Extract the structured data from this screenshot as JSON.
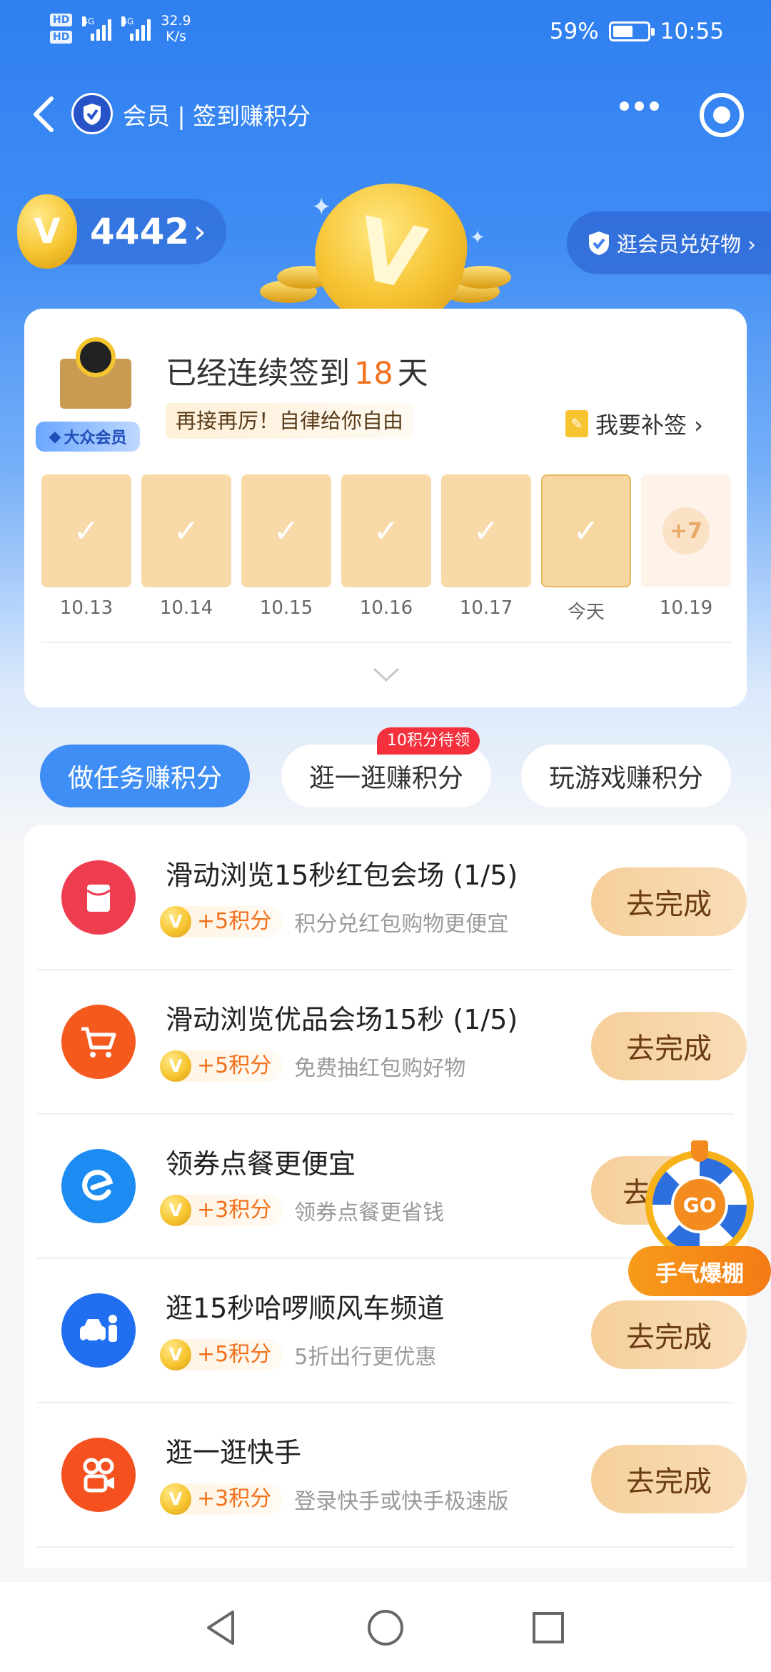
{
  "status_bar": {
    "hd1": "HD",
    "hd2": "HD",
    "net1": "4G",
    "net2": "4G",
    "speed_value": "32.9",
    "speed_unit": "K/s",
    "battery": "59%",
    "battery_level": 0.59,
    "time": "10:55"
  },
  "nav": {
    "title": "会员 | 签到赚积分"
  },
  "points": {
    "value": "4442",
    "arrow": "›"
  },
  "mall_button": "逛会员兑好物 ›",
  "sign_card": {
    "streak_prefix": "已经连续签到",
    "streak_days": "18",
    "streak_suffix": "天",
    "member_badge": "大众会员",
    "motto": "再接再厉！自律给你自由",
    "makeup_label": "我要补签 ›",
    "days": [
      {
        "label": "10.13",
        "state": "checked"
      },
      {
        "label": "10.14",
        "state": "checked"
      },
      {
        "label": "10.15",
        "state": "checked"
      },
      {
        "label": "10.16",
        "state": "checked"
      },
      {
        "label": "10.17",
        "state": "checked"
      },
      {
        "label": "今天",
        "state": "today"
      },
      {
        "label": "10.19",
        "state": "future",
        "reward": "+7"
      }
    ]
  },
  "tabs": [
    {
      "label": "做任务赚积分",
      "active": true
    },
    {
      "label": "逛一逛赚积分",
      "active": false,
      "badge": "10积分待领"
    },
    {
      "label": "玩游戏赚积分",
      "active": false
    }
  ],
  "tasks": [
    {
      "title": "滑动浏览15秒红包会场 (1/5)",
      "reward": "+5积分",
      "desc": "积分兑红包购物更便宜",
      "button": "去完成",
      "icon": "red-envelope-icon",
      "color": "#ef3d50"
    },
    {
      "title": "滑动浏览优品会场15秒 (1/5)",
      "reward": "+5积分",
      "desc": "免费抽红包购好物",
      "button": "去完成",
      "icon": "shopping-cart-icon",
      "color": "#f45a1d"
    },
    {
      "title": "领券点餐更便宜",
      "reward": "+3积分",
      "desc": "领券点餐更省钱",
      "button": "去完",
      "icon": "eleme-icon",
      "color": "#1d8cf2"
    },
    {
      "title": "逛15秒哈啰顺风车频道",
      "reward": "+5积分",
      "desc": "5折出行更优惠",
      "button": "去完成",
      "icon": "carpool-icon",
      "color": "#1f6ff0"
    },
    {
      "title": "逛一逛快手",
      "reward": "+3积分",
      "desc": "登录快手或快手极速版",
      "button": "去完成",
      "icon": "kuaishou-icon",
      "color": "#f4511e"
    }
  ],
  "coin_glyph": "V",
  "check_glyph": "✓",
  "wheel": {
    "go": "GO",
    "label": "手气爆棚"
  }
}
